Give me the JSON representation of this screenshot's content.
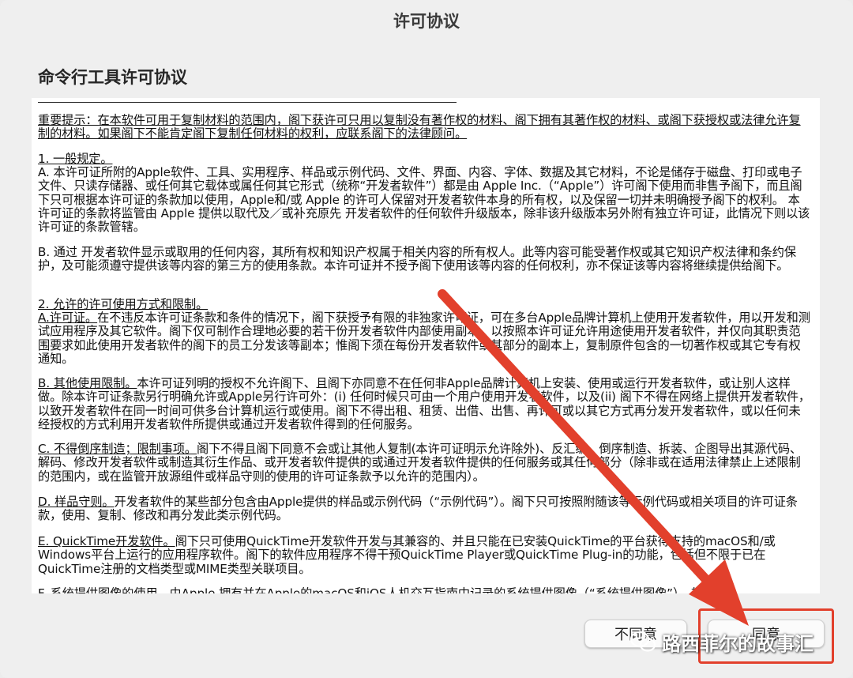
{
  "window": {
    "title": "许可协议"
  },
  "heading": "命令行工具许可协议",
  "license": {
    "p0": "重要提示：在本软件可用于复制材料的范围内，阁下获许可只用以复制没有著作权的材料、阁下拥有其著作权的材料、或阁下获授权或法律允许复制的材料。如果阁下不能肯定阁下复制任何材料的权利，应联系阁下的法律顾问。",
    "p1_title": "1. 一般规定。",
    "p1_a": "A. 本许可证所附的Apple软件、工具、实用程序、样品或示例代码、文件、界面、内容、字体、数据及其它材料，不论是储存于磁盘、打印或电子文件、只读存储器、或任何其它载体或属任何其它形式（统称“开发者软件”）都是由 Apple Inc.（“Apple”）许可阁下使用而非售予阁下，而且阁下只可根据本许可证的条款加以使用，Apple和/或 Apple 的许可人保留对开发者软件本身的所有权，以及保留一切并未明确授予阁下的权利。 本许可证的条款将监管由 Apple 提供以取代及／或补充原先 开发者软件的任何软件升级版本，除非该升级版本另外附有独立许可证，此情况下则以该许可证的条款管辖。",
    "p1_b": "B. 通过 开发者软件显示或取用的任何内容，其所有权和知识产权属于相关内容的所有权人。此等内容可能受著作权或其它知识产权法律和条约保护，及可能须遵守提供该等内容的第三方的使用条款。本许可证并不授予阁下使用该等内容的任何权利，亦不保证该等内容将继续提供给阁下。",
    "p2_title": "2. 允许的许可使用方式和限制。",
    "p2_a_lead": "A.许可证。",
    "p2_a": "在不违反本许可证条款和条件的情况下，阁下获授予有限的非独家许可证，可在多台Apple品牌计算机上使用开发者软件，用以开发和测试应用程序及其它软件。阁下仅可制作合理地必要的若干份开发者软件内部使用副本，以按照本许可证允许用途使用开发者软件，并仅向其职责范围要求如此使用开发者软件的阁下的员工分发该等副本；惟阁下须在每份开发者软件或其部分的副本上，复制原件包含的一切著作权或其它专有权通知。",
    "p2_b_lead": "B. 其他使用限制。",
    "p2_b": "本许可证列明的授权不允许阁下、且阁下亦同意不在任何非Apple品牌计算机上安装、使用或运行开发者软件，或让别人这样做。除本许可证条款另行明确允许或Apple另行许可外：(i) 任何时候只可由一个用户使用开发者软件，以及(ii) 阁下不得在网络上提供开发者软件，以致开发者软件在同一时间可供多台计算机运行或使用。阁下不得出租、租赁、出借、出售、再许可或以其它方式再分发开发者软件，或以任何未经授权的方式利用开发者软件所提供或通过开发者软件得到的任何服务。",
    "p2_c_lead": "C. 不得倒序制造；限制事项。",
    "p2_c": "阁下不得且阁下同意不会或让其他人复制(本许可证明示允许除外)、反汇编、倒序制造、拆装、企图导出其源代码、解码、修改开发者软件或制造其衍生作品、或开发者软件提供的或通过开发者软件提供的任何服务或其任何部分（除非或在适用法律禁止上述限制的范围内，或在监管开放源组件或样品守则的使用的许可证条款予以允许的范围内）。",
    "p2_d_lead": "D. 样品守则。",
    "p2_d": "开发者软件的某些部分包含由Apple提供的样品或示例代码（“示例代码”）。阁下只可按照附随该等示例代码或相关项目的许可证条款，使用、复制、修改和再分发此类示例代码。",
    "p2_e_lead": "E. QuickTime开发软件。",
    "p2_e": "阁下只可使用QuickTime开发软件开发与其兼容的、并且只能在已安装QuickTime的平台获得支持的macOS和/或Windows平台上运行的应用程序软件。阁下的软件应用程序不得干预QuickTime Player或QuickTime Plug-in的功能，包括但不限于已在QuickTime注册的文档类型或MIME类型关联项目。",
    "p2_f_cut": "F. 系统提供图像的使用。由Apple 拥有并在Apple的macOS和iOS人机交互指南中记录的系统提供图像（“系统提供图像”），其许"
  },
  "buttons": {
    "disagree": "不同意",
    "agree": "同意"
  },
  "watermark": {
    "text": "路西菲尔的故事汇"
  },
  "colors": {
    "annotation": "#e2402c"
  }
}
